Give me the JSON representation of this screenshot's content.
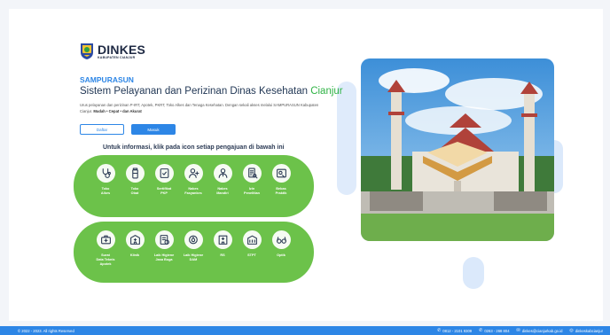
{
  "logo": {
    "title": "DINKES",
    "subtitle": "KABUPATEN CIANJUR"
  },
  "hero": {
    "brand": "SAMPURASUN",
    "headline_prefix": "Sistem Pelayanan dan Perizinan Dinas Kesehatan ",
    "headline_highlight": "Cianjur",
    "desc_main": "Urus pelayanan dan perizinan P-IRT, Apotek, PKRT, Toko Alkes dan Tenaga Kesehatan. Dengan sekali akses melalui SAMPURASUN Kabupaten Cianjur. ",
    "desc_bold": "Mudah • Cepat • dan Akurat"
  },
  "actions": {
    "register": "Daftar",
    "login": "Masuk"
  },
  "services_title": "Untuk informasi, klik pada icon setiap pengajuan di bawah ini",
  "services": {
    "row1": [
      {
        "label": "Toko\nAlkes",
        "icon": "stethoscope-icon"
      },
      {
        "label": "Toko\nObat",
        "icon": "medicine-bottle-icon"
      },
      {
        "label": "Sertifikat\nPKP",
        "icon": "certificate-icon"
      },
      {
        "label": "Nakes\nFasyankes",
        "icon": "health-worker-icon"
      },
      {
        "label": "Nakes\nMandiri",
        "icon": "doctor-icon"
      },
      {
        "label": "Izin\nPenelitian",
        "icon": "research-document-icon"
      },
      {
        "label": "Bebas\nPraktik",
        "icon": "free-practice-icon"
      }
    ],
    "row2": [
      {
        "label": "Surat\nData Teknis\nApotek",
        "icon": "pharmacy-kit-icon"
      },
      {
        "label": "Klinik",
        "icon": "clinic-icon"
      },
      {
        "label": "Laik Higiene\nJasa Boga",
        "icon": "catering-icon"
      },
      {
        "label": "Laik Higiene\nDAM",
        "icon": "water-depot-icon"
      },
      {
        "label": "RS",
        "icon": "hospital-icon"
      },
      {
        "label": "STPT",
        "icon": "building-icon"
      },
      {
        "label": "Optik",
        "icon": "glasses-icon"
      }
    ]
  },
  "footer": {
    "copyright": "© 2022 - 2023. All rights Reserved",
    "phone1": "0812 - 2101 9309",
    "phone2": "0263 - 268 804",
    "email": "dinkes@cianjurkab.go.id",
    "instagram": "dinkeskabcianjur"
  },
  "colors": {
    "primary": "#2d86e6",
    "panel": "#6cc24a",
    "highlight": "#2fb345"
  }
}
